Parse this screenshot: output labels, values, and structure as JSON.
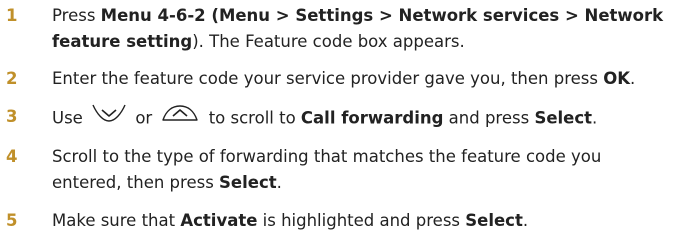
{
  "colors": {
    "step_number": "#c0902a",
    "text": "#222222"
  },
  "steps": [
    {
      "num": "1",
      "line1": {
        "t1": "Press ",
        "b1": "Menu 4-6-2 (Menu > Settings > Network services > Network"
      },
      "line2": {
        "b1": "feature setting",
        "t1": "). The Feature code box appears."
      }
    },
    {
      "num": "2",
      "line1": {
        "t1": "Enter the feature code your service provider gave you, then press ",
        "b1": "OK",
        "t2": "."
      }
    },
    {
      "num": "3",
      "line1": {
        "t1": "Use",
        "icon1": "scroll-down-key-icon",
        "t2": "or",
        "icon2": "scroll-up-key-icon",
        "t3": "to scroll to ",
        "b1": "Call forwarding",
        "t4": " and press ",
        "b2": "Select",
        "t5": "."
      }
    },
    {
      "num": "4",
      "line1": {
        "t1": "Scroll to the type of forwarding that matches the feature code you"
      },
      "line2": {
        "t1": "entered, then press ",
        "b1": "Select",
        "t2": "."
      }
    },
    {
      "num": "5",
      "line1": {
        "t1": "Make sure that ",
        "b1": "Activate",
        "t2": " is highlighted and press ",
        "b2": "Select",
        "t3": "."
      }
    }
  ]
}
